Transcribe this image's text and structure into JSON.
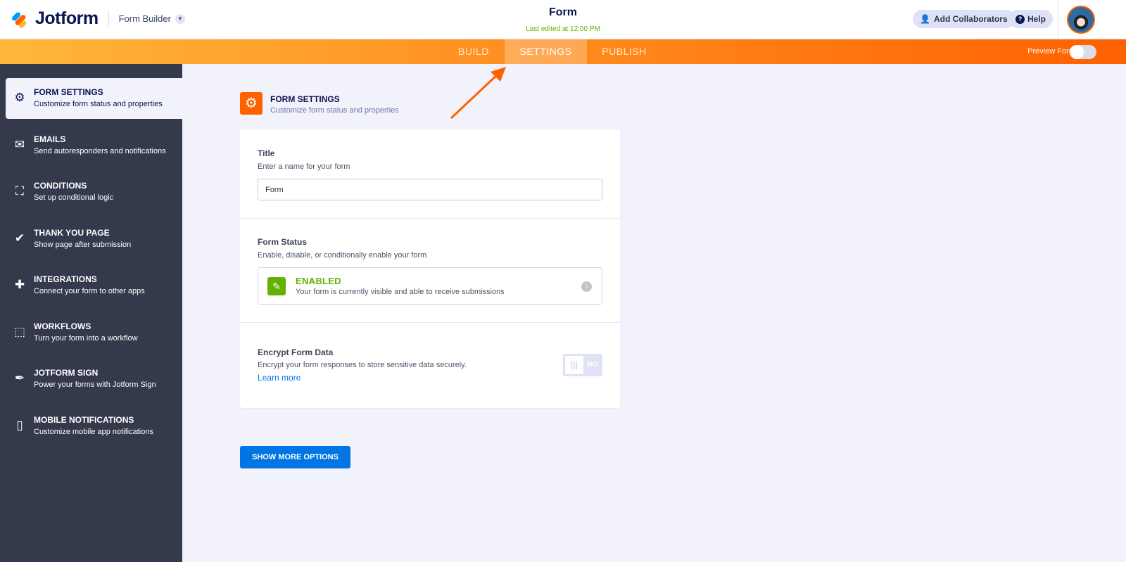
{
  "header": {
    "logo": "Jotform",
    "product": "Form Builder",
    "form_title": "Form",
    "last_edited": "Last edited at 12:00 PM",
    "add_collaborators": "Add Collaborators",
    "help": "Help"
  },
  "nav": {
    "tabs": [
      {
        "label": "BUILD"
      },
      {
        "label": "SETTINGS",
        "active": true
      },
      {
        "label": "PUBLISH"
      }
    ],
    "preview_label": "Preview Form",
    "preview_on": false
  },
  "sidebar": {
    "items": [
      {
        "title": "FORM SETTINGS",
        "desc": "Customize form status and properties",
        "icon": "gear-icon",
        "active": true
      },
      {
        "title": "EMAILS",
        "desc": "Send autoresponders and notifications",
        "icon": "envelope-icon"
      },
      {
        "title": "CONDITIONS",
        "desc": "Set up conditional logic",
        "icon": "hierarchy-icon"
      },
      {
        "title": "THANK YOU PAGE",
        "desc": "Show page after submission",
        "icon": "check-circle-icon"
      },
      {
        "title": "INTEGRATIONS",
        "desc": "Connect your form to other apps",
        "icon": "puzzle-icon"
      },
      {
        "title": "WORKFLOWS",
        "desc": "Turn your form into a workflow",
        "icon": "workflow-icon"
      },
      {
        "title": "JOTFORM SIGN",
        "desc": "Power your forms with Jotform Sign",
        "icon": "pen-icon"
      },
      {
        "title": "MOBILE NOTIFICATIONS",
        "desc": "Customize mobile app notifications",
        "icon": "mobile-icon"
      }
    ]
  },
  "main": {
    "title": "FORM SETTINGS",
    "subtitle": "Customize form status and properties",
    "title_field": {
      "label": "Title",
      "desc": "Enter a name for your form",
      "value": "Form"
    },
    "status": {
      "label": "Form Status",
      "desc": "Enable, disable, or conditionally enable your form",
      "state": "ENABLED",
      "state_desc": "Your form is currently visible and able to receive submissions"
    },
    "encrypt": {
      "label": "Encrypt Form Data",
      "desc": "Encrypt your form responses to store sensitive data securely.",
      "learn_more": "Learn more",
      "toggle": "NO"
    },
    "show_more": "SHOW MORE OPTIONS"
  },
  "colors": {
    "accent": "#ff6100",
    "sidebar": "#343a4c",
    "enabled": "#64b200",
    "button": "#0075e3"
  }
}
